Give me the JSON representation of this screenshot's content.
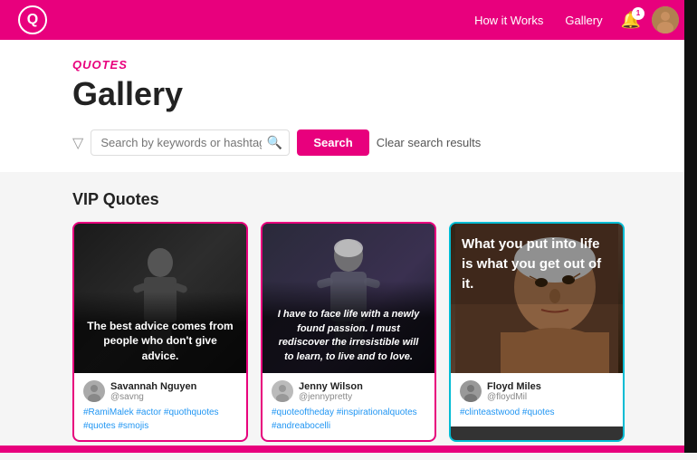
{
  "header": {
    "logo_letter": "Q",
    "nav": [
      {
        "label": "How it Works",
        "id": "how-it-works"
      },
      {
        "label": "Gallery",
        "id": "gallery"
      }
    ],
    "notif_count": "1"
  },
  "page": {
    "section_label": "Quotes",
    "title": "Gallery"
  },
  "search": {
    "placeholder": "Search by keywords or hashtags",
    "search_button": "Search",
    "clear_label": "Clear search results"
  },
  "vip": {
    "section_title": "VIP Quotes",
    "cards": [
      {
        "quote": "The best advice comes from people who don't give advice.",
        "user_name": "Savannah Nguyen",
        "user_handle": "@savng",
        "tags": "#RamiMalek #actor #quothquotes\n#quotes #smojis"
      },
      {
        "quote": "I have to face life with a newly found passion. I must rediscover the irresistible will to learn, to live and to love.",
        "user_name": "Jenny Wilson",
        "user_handle": "@jennypretty",
        "tags": "#quoteoftheday #inspirationalquotes\n#andreabocelli"
      },
      {
        "quote": "What you put into life is what you get out of it.",
        "user_name": "Floyd Miles",
        "user_handle": "@floydMil",
        "tags": "#clinteastwood #quotes"
      }
    ]
  }
}
